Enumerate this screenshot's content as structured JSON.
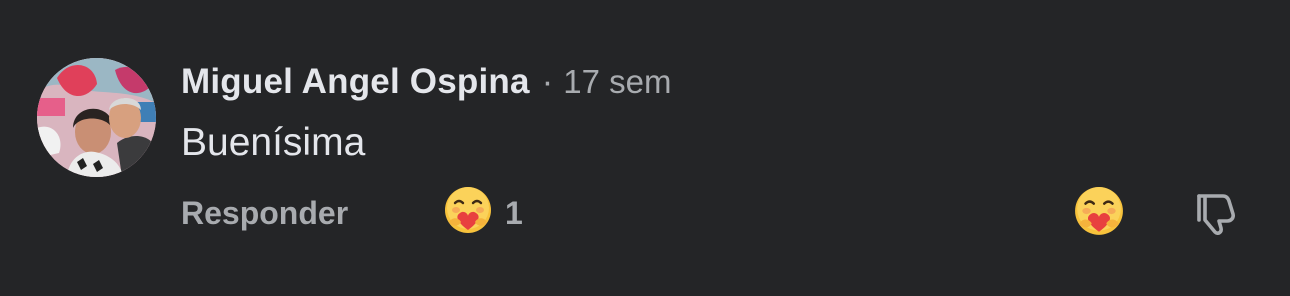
{
  "comment": {
    "author": "Miguel Angel Ospina",
    "separator": "·",
    "timestamp": "17 sem",
    "text": "Buenísima",
    "reply_label": "Responder",
    "reaction_count": "1",
    "reaction_icon": "care-hug-emoji",
    "dislike_icon": "thumbs-down-icon"
  },
  "colors": {
    "background": "#242527",
    "primary_text": "#e4e6eb",
    "secondary_text": "#a8abaf",
    "emoji_face": "#f7c23c",
    "emoji_heart": "#e8403f"
  }
}
